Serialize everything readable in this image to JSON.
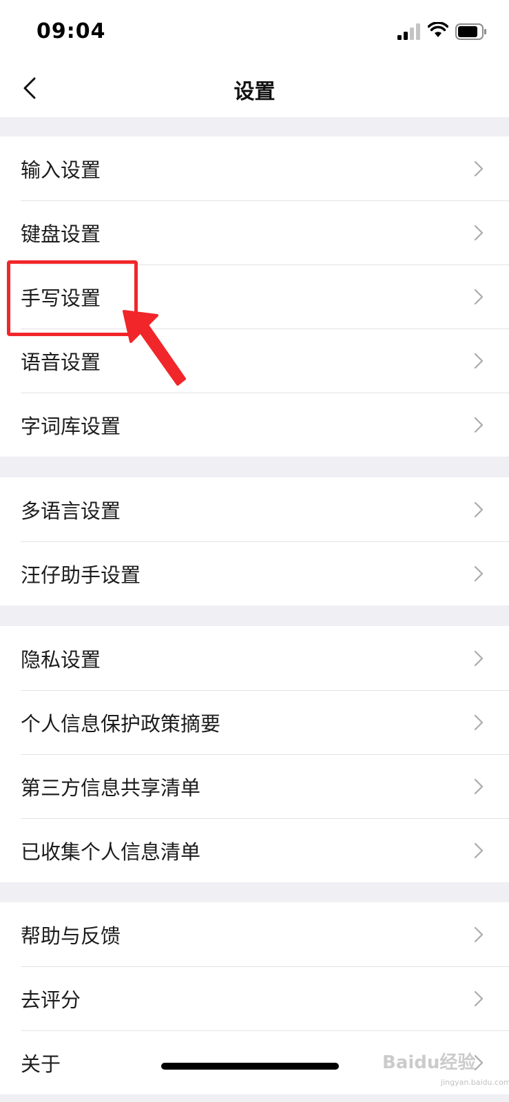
{
  "status_bar": {
    "time": "09:04"
  },
  "nav": {
    "title": "设置"
  },
  "groups": [
    {
      "items": [
        {
          "label": "输入设置"
        },
        {
          "label": "键盘设置"
        },
        {
          "label": "手写设置"
        },
        {
          "label": "语音设置"
        },
        {
          "label": "字词库设置"
        }
      ]
    },
    {
      "items": [
        {
          "label": "多语言设置"
        },
        {
          "label": "汪仔助手设置"
        }
      ]
    },
    {
      "items": [
        {
          "label": "隐私设置"
        },
        {
          "label": "个人信息保护政策摘要"
        },
        {
          "label": "第三方信息共享清单"
        },
        {
          "label": "已收集个人信息清单"
        }
      ]
    },
    {
      "items": [
        {
          "label": "帮助与反馈"
        },
        {
          "label": "去评分"
        },
        {
          "label": "关于"
        }
      ]
    }
  ],
  "annotation": {
    "highlighted_item": "手写设置",
    "color": "#f1262a"
  },
  "watermark": {
    "text": "Baidu经验",
    "sub": "jingyan.baidu.com"
  }
}
